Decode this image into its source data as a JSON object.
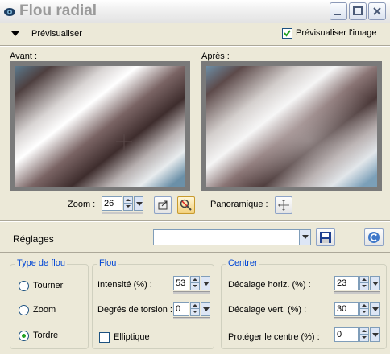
{
  "window": {
    "title": "Flou radial"
  },
  "preview_bar": {
    "toggle_label": "Prévisualiser",
    "preview_image_label": "Prévisualiser l'image",
    "preview_image_checked": true
  },
  "panes": {
    "before_label": "Avant :",
    "after_label": "Après :"
  },
  "zoom": {
    "label": "Zoom :",
    "value": "26"
  },
  "pan": {
    "label": "Panoramique :"
  },
  "presets": {
    "label": "Réglages",
    "value": ""
  },
  "blur_type": {
    "title": "Type de flou",
    "options": [
      "Tourner",
      "Zoom",
      "Tordre"
    ],
    "selected": "Tordre"
  },
  "blur": {
    "title": "Flou",
    "intensity_label": "Intensité (%) :",
    "intensity_value": "53",
    "twist_label": "Degrés de torsion :",
    "twist_value": "0",
    "elliptical_label": "Elliptique",
    "elliptical_checked": false
  },
  "center": {
    "title": "Centrer",
    "h_offset_label": "Décalage horiz. (%) :",
    "h_offset_value": "23",
    "v_offset_label": "Décalage vert. (%) :",
    "v_offset_value": "30",
    "protect_label": "Protéger le centre (%) :",
    "protect_value": "0"
  },
  "colors": {
    "group_title": "#0046d5",
    "check_green": "#21a121"
  }
}
